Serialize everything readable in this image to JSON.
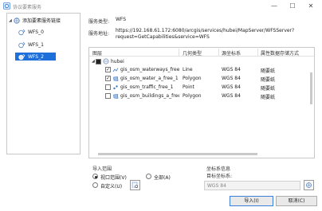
{
  "window": {
    "title": "协议要素服务",
    "minimize": "—",
    "maximize": "☐",
    "close": "✕"
  },
  "sidebar": {
    "root_label": "添加要素服务链接",
    "items": [
      {
        "label": "WFS_0"
      },
      {
        "label": "WFS_1"
      },
      {
        "label": "WFS_2"
      }
    ]
  },
  "service": {
    "type_label": "服务类型:",
    "type_value": "WFS",
    "url_label": "服务地址:",
    "url_line1": "https://192.168.61.172:6080/arcgis/services/hubei/MapServer/WFSServer?",
    "url_line2": "request=GetCapabilities&service=WFS"
  },
  "layers": {
    "headers": [
      "图层",
      "几何类型",
      "源坐标系",
      "属性数据存储方式"
    ],
    "group": {
      "label": "hubei"
    },
    "rows": [
      {
        "name": "gis_osm_waterways_free_",
        "geom": "Line",
        "crs": "WGS 84",
        "store": "随要纸",
        "checked": true
      },
      {
        "name": "gis_osm_water_a_free_1",
        "geom": "Polygon",
        "crs": "WGS 84",
        "store": "随要纸",
        "checked": true
      },
      {
        "name": "gis_osm_traffic_free_1",
        "geom": "Point",
        "crs": "WGS 84",
        "store": "随要纸",
        "checked": false
      },
      {
        "name": "gis_osm_buildings_a_free",
        "geom": "Polygon",
        "crs": "WGS 84",
        "store": "随要纸",
        "checked": false
      }
    ]
  },
  "import_range": {
    "title": "导入范围",
    "option_view": "视口范围(V)",
    "option_all": "全部(A)",
    "option_custom": "自定义(U)"
  },
  "crs_section": {
    "title": "坐标系信息",
    "target_label": "目标坐标系:",
    "target_value": "WGS 84"
  },
  "buttons": {
    "import": "导入(I)",
    "cancel": "取消(C)"
  },
  "colors": {
    "selection": "#1e6fd9",
    "primary_border": "#3c7fd9"
  }
}
